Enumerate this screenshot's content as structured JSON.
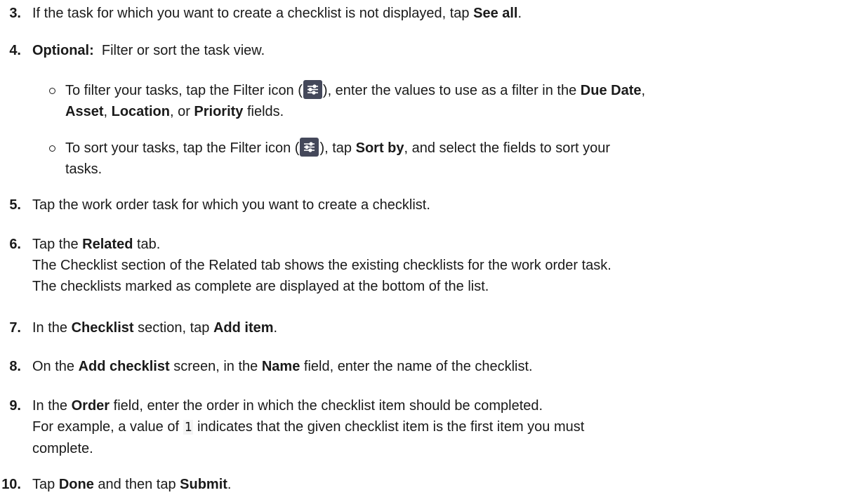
{
  "steps": [
    {
      "num": "3.",
      "pre": "If the task for which you want to create a checklist is not displayed, tap ",
      "b1": "See all",
      "post": "."
    },
    {
      "num": "4.",
      "b1": "Optional:",
      "post": "  Filter or sort the task view."
    },
    {
      "num": "5.",
      "pre": "Tap the work order task for which you want to create a checklist."
    },
    {
      "num": "6.",
      "pre": "Tap the ",
      "b1": "Related",
      "post": " tab.",
      "note1": "The Checklist section of the Related tab shows the existing checklists for the work order task.",
      "note2": "The checklists marked as complete are displayed at the bottom of the list."
    },
    {
      "num": "7.",
      "pre": "In the ",
      "b1": "Checklist",
      "mid": " section, tap ",
      "b2": "Add item",
      "post": "."
    },
    {
      "num": "8.",
      "pre": "On the ",
      "b1": "Add checklist",
      "mid": " screen, in the ",
      "b2": "Name",
      "post": " field, enter the name of the checklist."
    },
    {
      "num": "9.",
      "pre": "In the ",
      "b1": "Order",
      "post": " field, enter the order in which the checklist item should be completed.",
      "note1a": "For example, a value of ",
      "code": "1",
      "note1b": " indicates that the given checklist item is the first item you must",
      "note2": "complete."
    },
    {
      "num": "10.",
      "pre": "Tap ",
      "b1": "Done",
      "mid": " and then tap ",
      "b2": "Submit",
      "post": "."
    }
  ],
  "substeps": [
    {
      "pre": "To filter your tasks, tap the Filter icon (",
      "icon": "filter-icon",
      "mid": "), enter the values to use as a filter in the ",
      "b1": "Due Date",
      "sep1": ",",
      "b2": "Asset",
      "sep2": ", ",
      "b3": "Location",
      "sep3": ", or ",
      "b4": "Priority",
      "post": " fields."
    },
    {
      "pre": "To sort your tasks, tap the Filter icon (",
      "icon": "filter-icon",
      "mid": "), tap ",
      "b1": "Sort by",
      "post": ", and select the fields to sort your",
      "line2": "tasks."
    }
  ]
}
